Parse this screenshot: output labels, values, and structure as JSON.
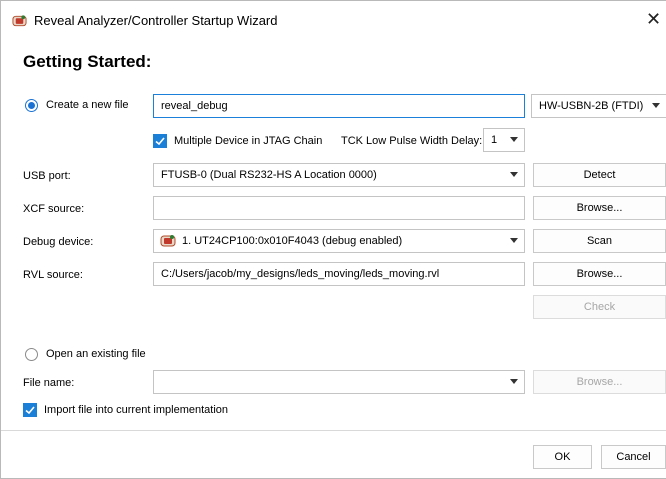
{
  "window": {
    "title": "Reveal Analyzer/Controller Startup Wizard",
    "close": "✕"
  },
  "heading": "Getting Started:",
  "create_new": {
    "label": "Create a new file",
    "name_value": "reveal_debug",
    "cable": "HW-USBN-2B (FTDI)",
    "multi_device_label": "Multiple Device in JTAG Chain",
    "tck_label": "TCK Low Pulse Width Delay:",
    "tck_value": "1"
  },
  "usb": {
    "label": "USB port:",
    "value": "FTUSB-0 (Dual RS232-HS A Location 0000)",
    "button": "Detect"
  },
  "xcf": {
    "label": "XCF source:",
    "value": "",
    "button": "Browse..."
  },
  "debug": {
    "label": "Debug device:",
    "value": "1. UT24CP100:0x010F4043 (debug enabled)",
    "button": "Scan"
  },
  "rvl": {
    "label": "RVL source:",
    "value": "C:/Users/jacob/my_designs/leds_moving/leds_moving.rvl",
    "button": "Browse..."
  },
  "check_button": "Check",
  "open_existing": {
    "label": "Open an existing file",
    "file_name_label": "File name:",
    "file_value": "",
    "button": "Browse...",
    "import_label": "Import file into current implementation"
  },
  "footer": {
    "ok": "OK",
    "cancel": "Cancel"
  },
  "colors": {
    "accent": "#1a7fd6",
    "border": "#c4c4c4",
    "disabled_text": "#a6a6a6"
  },
  "icons": [
    "app-icon",
    "close-icon",
    "chevron-down-icon",
    "checkmark-icon",
    "device-icon"
  ]
}
